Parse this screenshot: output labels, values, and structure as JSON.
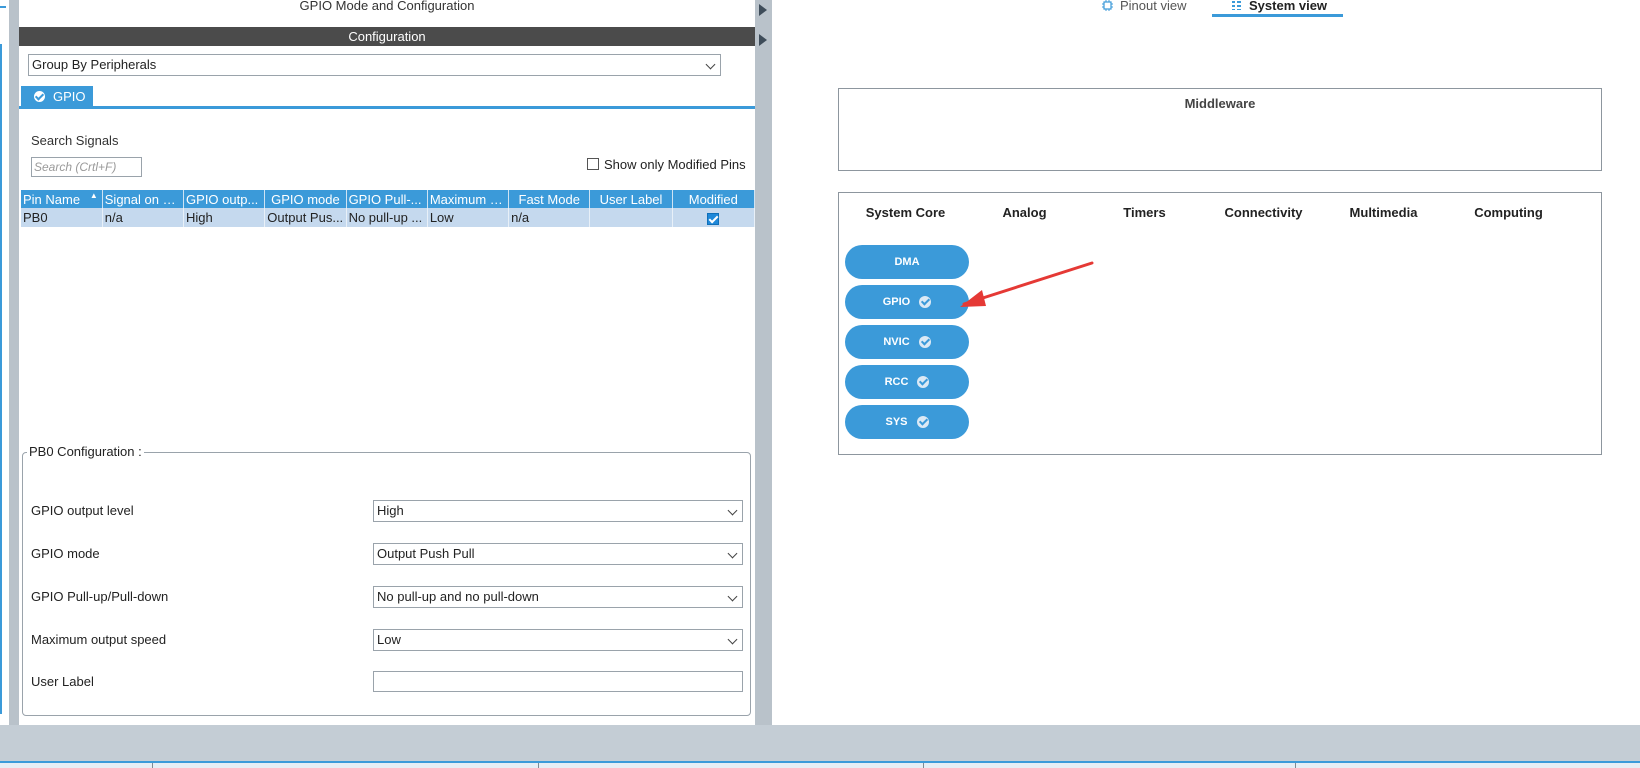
{
  "left_panel": {
    "title": "GPIO Mode and Configuration",
    "config_header": "Configuration",
    "group_by": "Group By Peripherals",
    "tab": "GPIO",
    "search_label": "Search Signals",
    "search_placeholder": "Search (Crtl+F)",
    "show_modified_label": "Show only Modified Pins",
    "table": {
      "columns": [
        "Pin Name",
        "Signal on Pin",
        "GPIO outp...",
        "GPIO mode",
        "GPIO Pull-...",
        "Maximum o...",
        "Fast Mode",
        "User Label",
        "Modified"
      ],
      "rows": [
        {
          "pin": "PB0",
          "signal": "n/a",
          "output": "High",
          "mode": "Output Pus...",
          "pull": "No pull-up ...",
          "speed": "Low",
          "fast": "n/a",
          "label": "",
          "modified": true
        }
      ]
    },
    "pb0_config": {
      "legend": "PB0 Configuration :",
      "fields": [
        {
          "label": "GPIO output level",
          "value": "High"
        },
        {
          "label": "GPIO mode",
          "value": "Output Push Pull"
        },
        {
          "label": "GPIO Pull-up/Pull-down",
          "value": "No pull-up and no pull-down"
        },
        {
          "label": "Maximum output speed",
          "value": "Low"
        },
        {
          "label": "User Label",
          "value": ""
        }
      ]
    }
  },
  "right_panel": {
    "tabs": [
      {
        "label": "Pinout view",
        "icon": "chip-icon",
        "active": false
      },
      {
        "label": "System view",
        "icon": "grid-icon",
        "active": true
      }
    ],
    "middleware_title": "Middleware",
    "categories": [
      "System Core",
      "Analog",
      "Timers",
      "Connectivity",
      "Multimedia",
      "Computing"
    ],
    "system_core_items": [
      {
        "label": "DMA",
        "configured": false
      },
      {
        "label": "GPIO",
        "configured": true
      },
      {
        "label": "NVIC",
        "configured": true
      },
      {
        "label": "RCC",
        "configured": true
      },
      {
        "label": "SYS",
        "configured": true
      }
    ]
  },
  "colors": {
    "accent": "#3b9ad9",
    "header_dark": "#4b4b4b",
    "selected_row": "#c5d9ee",
    "annotation_arrow": "#e53935"
  }
}
